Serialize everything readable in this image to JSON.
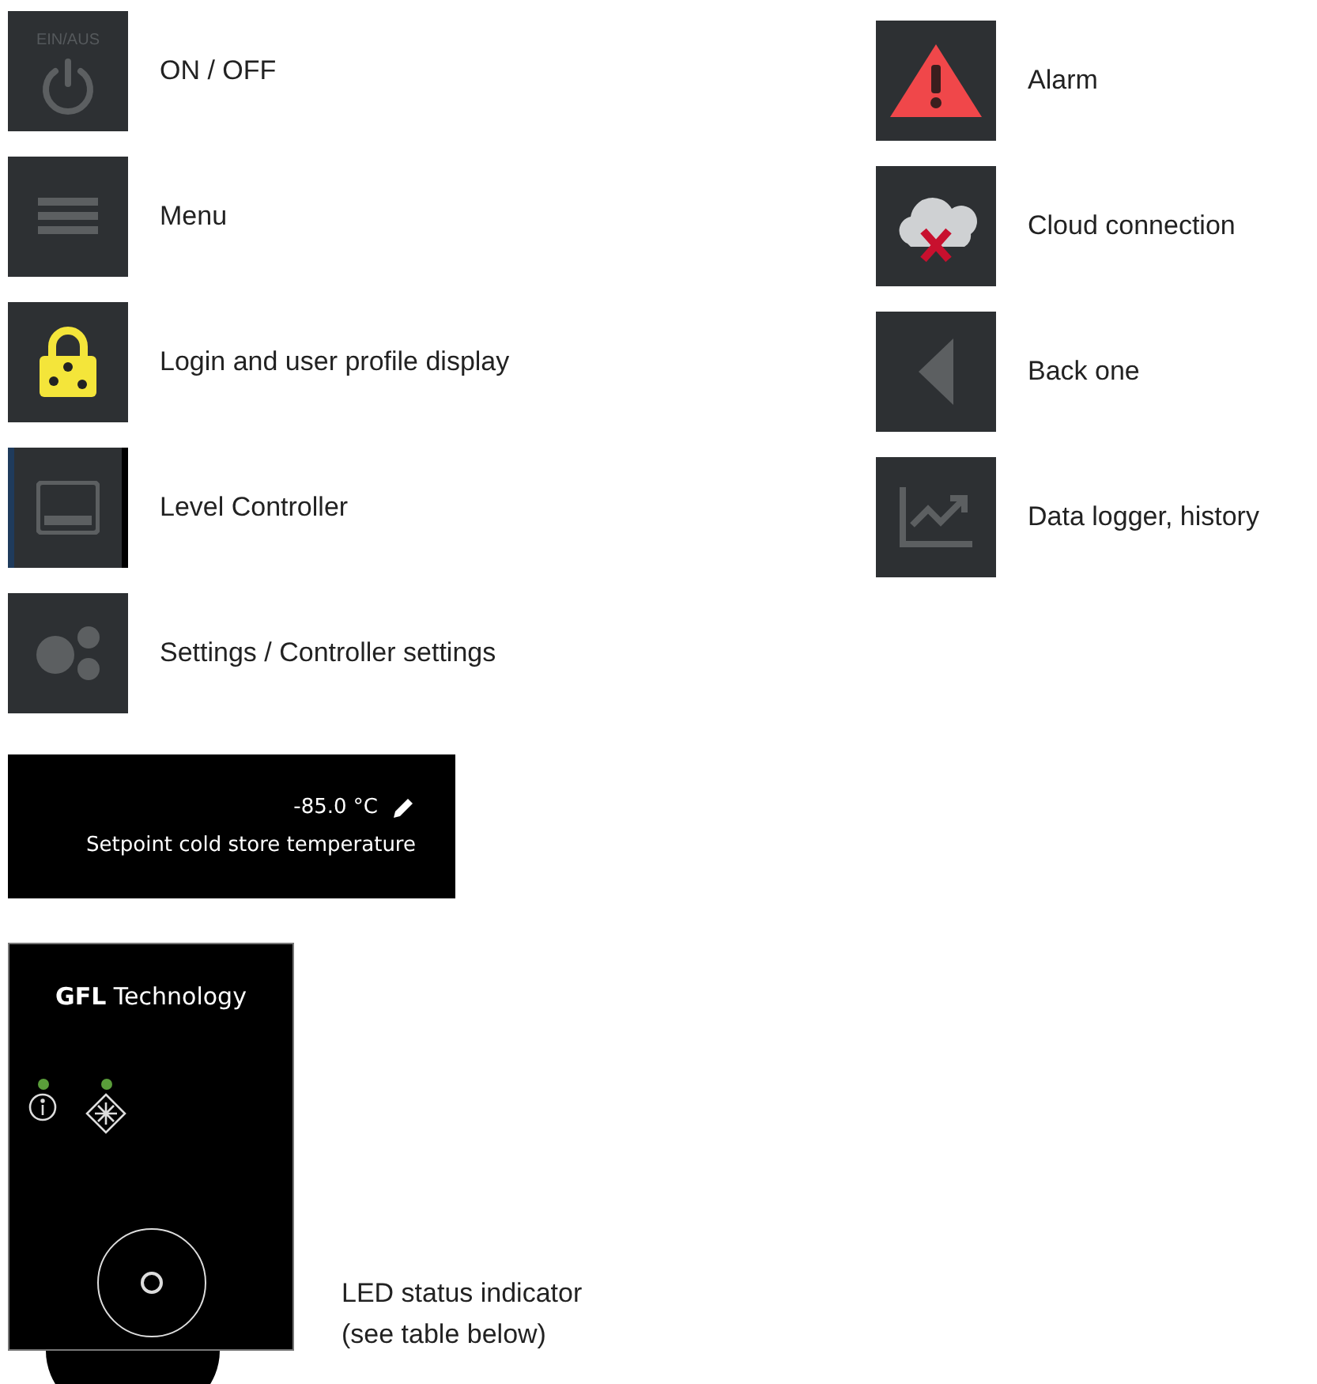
{
  "icons_left": [
    {
      "kind": "power",
      "badge": "EIN/AUS",
      "label": "ON / OFF"
    },
    {
      "kind": "menu",
      "label": "Menu"
    },
    {
      "kind": "lock",
      "label": "Login and user profile display"
    },
    {
      "kind": "controller",
      "label": "Level Controller"
    },
    {
      "kind": "gears",
      "label": "Settings / Controller settings"
    }
  ],
  "icons_right": [
    {
      "kind": "alarm",
      "label": "Alarm"
    },
    {
      "kind": "cloud",
      "label": "Cloud connection"
    },
    {
      "kind": "back",
      "label": "Back one"
    },
    {
      "kind": "chart",
      "label": "Data logger, history"
    }
  ],
  "setpoint": {
    "value": "-85.0 °C",
    "label": "Setpoint cold store temperature"
  },
  "device": {
    "brand": "**GFL** Technology",
    "leds": [
      {
        "kind": "info",
        "lit": true
      },
      {
        "kind": "snow",
        "lit": true
      }
    ],
    "caption": [
      "LED status indicator",
      "(see table below)"
    ]
  }
}
